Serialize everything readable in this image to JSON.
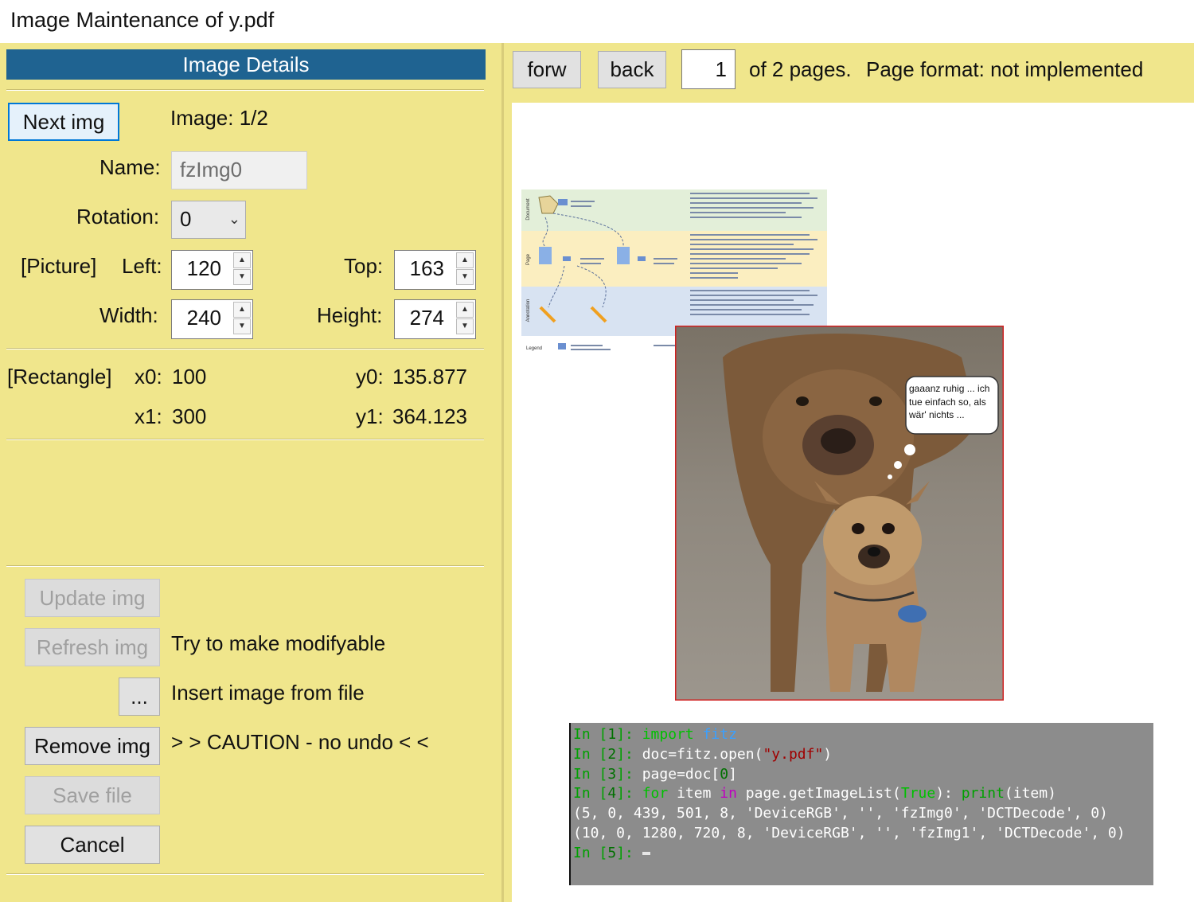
{
  "window": {
    "title": "Image Maintenance of y.pdf"
  },
  "details": {
    "header": "Image Details",
    "next_img_label": "Next img",
    "image_counter": "Image: 1/2",
    "name_label": "Name:",
    "name_value": "fzImg0",
    "rotation_label": "Rotation:",
    "rotation_value": "0",
    "picture_label": "[Picture]",
    "left_label": "Left:",
    "left_value": "120",
    "top_label": "Top:",
    "top_value": "163",
    "width_label": "Width:",
    "width_value": "240",
    "height_label": "Height:",
    "height_value": "274",
    "rect_label": "[Rectangle]",
    "x0_label": "x0:",
    "x0_value": "100",
    "y0_label": "y0:",
    "y0_value": "135.877",
    "x1_label": "x1:",
    "x1_value": "300",
    "y1_label": "y1:",
    "y1_value": "364.123"
  },
  "actions": {
    "update_label": "Update img",
    "refresh_label": "Refresh img",
    "refresh_hint": "Try to make modifyable",
    "browse_label": "...",
    "browse_hint": "Insert image from file",
    "remove_label": "Remove img",
    "remove_hint": "> > CAUTION - no undo < <",
    "save_label": "Save file",
    "cancel_label": "Cancel"
  },
  "toolbar": {
    "forw_label": "forw",
    "back_label": "back",
    "page_number": "1",
    "page_info": "of 2 pages.",
    "page_format": "Page format: not implemented"
  },
  "page_preview": {
    "diagram_section_labels": [
      "Document",
      "Page",
      "Annotation"
    ],
    "legend_label": "Legend",
    "speech_bubble": "gaaanz ruhig ... ich tue einfach so, als wär' nichts ..."
  },
  "console": {
    "lines": [
      [
        "In [",
        "1",
        "]: ",
        "import",
        " ",
        "fitz"
      ],
      [
        "In [",
        "2",
        "]: ",
        "doc=fitz.open(",
        "\"y.pdf\"",
        ")"
      ],
      [
        "In [",
        "3",
        "]: ",
        "page=doc[",
        "0",
        "]"
      ],
      [
        "In [",
        "4",
        "]: ",
        "for",
        " item ",
        "in",
        " page.getImageList(",
        "True",
        "): ",
        "print",
        "(item)"
      ],
      [
        "(5, 0, 439, 501, 8, 'DeviceRGB', '', 'fzImg0', 'DCTDecode', 0)"
      ],
      [
        "(10, 0, 1280, 720, 8, 'DeviceRGB', '', 'fzImg1', 'DCTDecode', 0)"
      ],
      [
        "In [",
        "5",
        "]: "
      ]
    ]
  }
}
